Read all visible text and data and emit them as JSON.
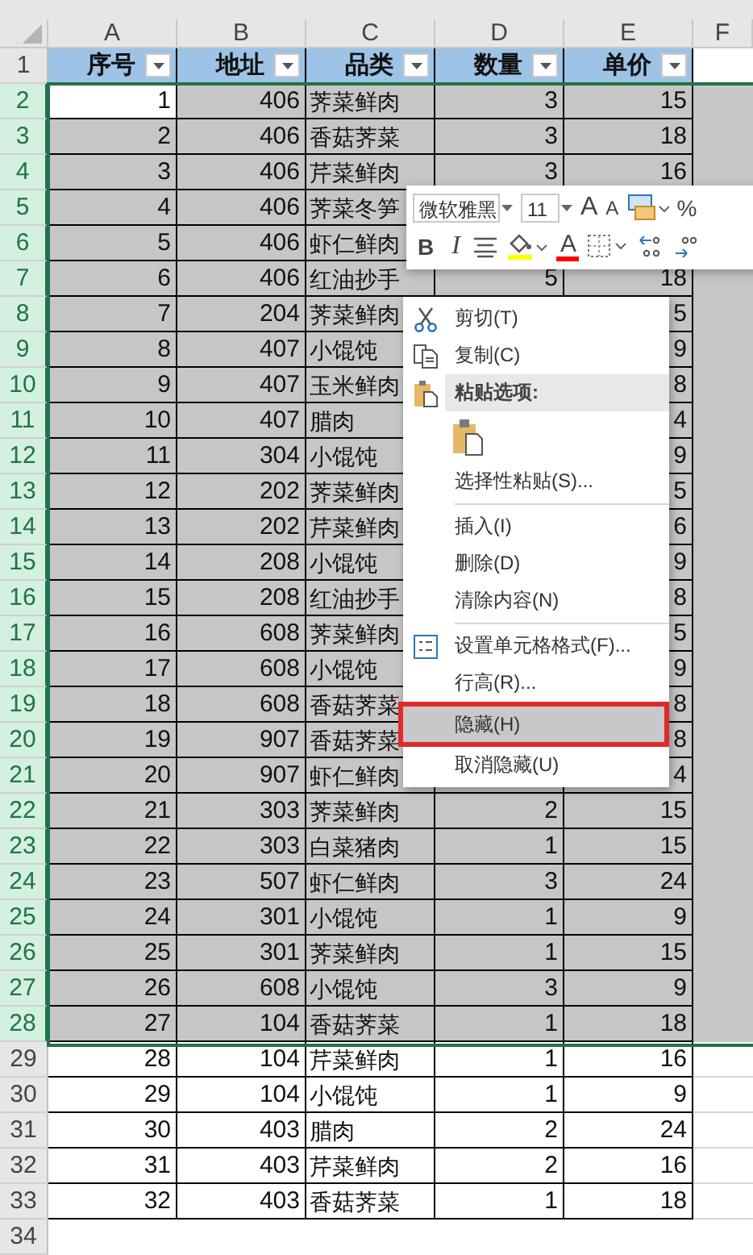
{
  "columns": [
    "A",
    "B",
    "C",
    "D",
    "E",
    "F"
  ],
  "header": {
    "row": "1",
    "cells": [
      "序号",
      "地址",
      "品类",
      "数量",
      "单价"
    ]
  },
  "rows": [
    {
      "row": "2",
      "selected": true,
      "active": true,
      "seq": "1",
      "address": "406",
      "category": "荠菜鲜肉",
      "quantity": "3",
      "price": "15"
    },
    {
      "row": "3",
      "selected": true,
      "seq": "2",
      "address": "406",
      "category": "香菇荠菜",
      "quantity": "3",
      "price": "18"
    },
    {
      "row": "4",
      "selected": true,
      "seq": "3",
      "address": "406",
      "category": "芹菜鲜肉",
      "quantity": "3",
      "price": "16"
    },
    {
      "row": "5",
      "selected": true,
      "seq": "4",
      "address": "406",
      "category": "荠菜冬笋"
    },
    {
      "row": "6",
      "selected": true,
      "seq": "5",
      "address": "406",
      "category": "虾仁鲜肉"
    },
    {
      "row": "7",
      "selected": true,
      "seq": "6",
      "address": "406",
      "category": "红油抄手",
      "quantity": "5",
      "price": "18"
    },
    {
      "row": "8",
      "selected": true,
      "seq": "7",
      "address": "204",
      "category": "荠菜鲜肉",
      "price": "5"
    },
    {
      "row": "9",
      "selected": true,
      "seq": "8",
      "address": "407",
      "category": "小馄饨",
      "price": "9"
    },
    {
      "row": "10",
      "selected": true,
      "seq": "9",
      "address": "407",
      "category": "玉米鲜肉",
      "price": "8"
    },
    {
      "row": "11",
      "selected": true,
      "seq": "10",
      "address": "407",
      "category": "腊肉",
      "price": "4"
    },
    {
      "row": "12",
      "selected": true,
      "seq": "11",
      "address": "304",
      "category": "小馄饨",
      "price": "9"
    },
    {
      "row": "13",
      "selected": true,
      "seq": "12",
      "address": "202",
      "category": "荠菜鲜肉",
      "price": "5"
    },
    {
      "row": "14",
      "selected": true,
      "seq": "13",
      "address": "202",
      "category": "芹菜鲜肉",
      "price": "6"
    },
    {
      "row": "15",
      "selected": true,
      "seq": "14",
      "address": "208",
      "category": "小馄饨",
      "price": "9"
    },
    {
      "row": "16",
      "selected": true,
      "seq": "15",
      "address": "208",
      "category": "红油抄手",
      "price": "8"
    },
    {
      "row": "17",
      "selected": true,
      "seq": "16",
      "address": "608",
      "category": "荠菜鲜肉",
      "price": "5"
    },
    {
      "row": "18",
      "selected": true,
      "seq": "17",
      "address": "608",
      "category": "小馄饨",
      "price": "9"
    },
    {
      "row": "19",
      "selected": true,
      "seq": "18",
      "address": "608",
      "category": "香菇荠菜",
      "price": "8"
    },
    {
      "row": "20",
      "selected": true,
      "seq": "19",
      "address": "907",
      "category": "香菇荠菜",
      "price": "8"
    },
    {
      "row": "21",
      "selected": true,
      "seq": "20",
      "address": "907",
      "category": "虾仁鲜肉",
      "price": "4"
    },
    {
      "row": "22",
      "selected": true,
      "seq": "21",
      "address": "303",
      "category": "荠菜鲜肉",
      "quantity": "2",
      "price": "15"
    },
    {
      "row": "23",
      "selected": true,
      "seq": "22",
      "address": "303",
      "category": "白菜猪肉",
      "quantity": "1",
      "price": "15"
    },
    {
      "row": "24",
      "selected": true,
      "seq": "23",
      "address": "507",
      "category": "虾仁鲜肉",
      "quantity": "3",
      "price": "24"
    },
    {
      "row": "25",
      "selected": true,
      "seq": "24",
      "address": "301",
      "category": "小馄饨",
      "quantity": "1",
      "price": "9"
    },
    {
      "row": "26",
      "selected": true,
      "seq": "25",
      "address": "301",
      "category": "荠菜鲜肉",
      "quantity": "1",
      "price": "15"
    },
    {
      "row": "27",
      "selected": true,
      "seq": "26",
      "address": "608",
      "category": "小馄饨",
      "quantity": "3",
      "price": "9"
    },
    {
      "row": "28",
      "selected": true,
      "seq": "27",
      "address": "104",
      "category": "香菇荠菜",
      "quantity": "1",
      "price": "18"
    },
    {
      "row": "29",
      "selected": false,
      "seq": "28",
      "address": "104",
      "category": "芹菜鲜肉",
      "quantity": "1",
      "price": "16"
    },
    {
      "row": "30",
      "selected": false,
      "seq": "29",
      "address": "104",
      "category": "小馄饨",
      "quantity": "1",
      "price": "9"
    },
    {
      "row": "31",
      "selected": false,
      "seq": "30",
      "address": "403",
      "category": "腊肉",
      "quantity": "2",
      "price": "24"
    },
    {
      "row": "32",
      "selected": false,
      "seq": "31",
      "address": "403",
      "category": "芹菜鲜肉",
      "quantity": "2",
      "price": "16"
    },
    {
      "row": "33",
      "selected": false,
      "seq": "32",
      "address": "403",
      "category": "香菇荠菜",
      "quantity": "1",
      "price": "18"
    }
  ],
  "empty_rows": [
    "34"
  ],
  "mini_toolbar": {
    "font": "微软雅黑",
    "size": "11",
    "top_buttons": [
      {
        "kind": "grow",
        "label": "A"
      },
      {
        "kind": "shrink",
        "label": "A"
      },
      {
        "kind": "styles"
      },
      {
        "kind": "percent",
        "label": "%"
      }
    ],
    "bottom_buttons": [
      {
        "kind": "bold",
        "label": "B"
      },
      {
        "kind": "italic",
        "label": "I"
      },
      {
        "kind": "align"
      },
      {
        "kind": "fill",
        "color": "#ffff00"
      },
      {
        "kind": "font-color",
        "label": "A",
        "color": "#ff0000"
      },
      {
        "kind": "borders"
      },
      {
        "kind": "increase-decimal"
      },
      {
        "kind": "decrease-decimal"
      }
    ]
  },
  "menu": {
    "items": [
      {
        "kind": "cut",
        "label": "剪切(T)",
        "selected": false
      },
      {
        "kind": "copy",
        "label": "复制(C)",
        "selected": false
      },
      {
        "kind": "paste-header",
        "label": "粘贴选项:"
      },
      {
        "kind": "paste-option",
        "selected": false
      },
      {
        "kind": "plain",
        "label": "选择性粘贴(S)...",
        "selected": false
      },
      {
        "kind": "plain",
        "label": "插入(I)",
        "selected": false,
        "separator_before": true
      },
      {
        "kind": "plain",
        "label": "删除(D)",
        "selected": false
      },
      {
        "kind": "plain",
        "label": "清除内容(N)",
        "selected": false
      },
      {
        "kind": "format",
        "label": "设置单元格格式(F)...",
        "selected": false,
        "separator_before": true
      },
      {
        "kind": "plain",
        "label": "行高(R)...",
        "selected": false
      },
      {
        "kind": "plain",
        "label": "隐藏(H)",
        "selected": true,
        "outlined": true
      },
      {
        "kind": "plain",
        "label": "取消隐藏(U)",
        "selected": false
      }
    ]
  }
}
